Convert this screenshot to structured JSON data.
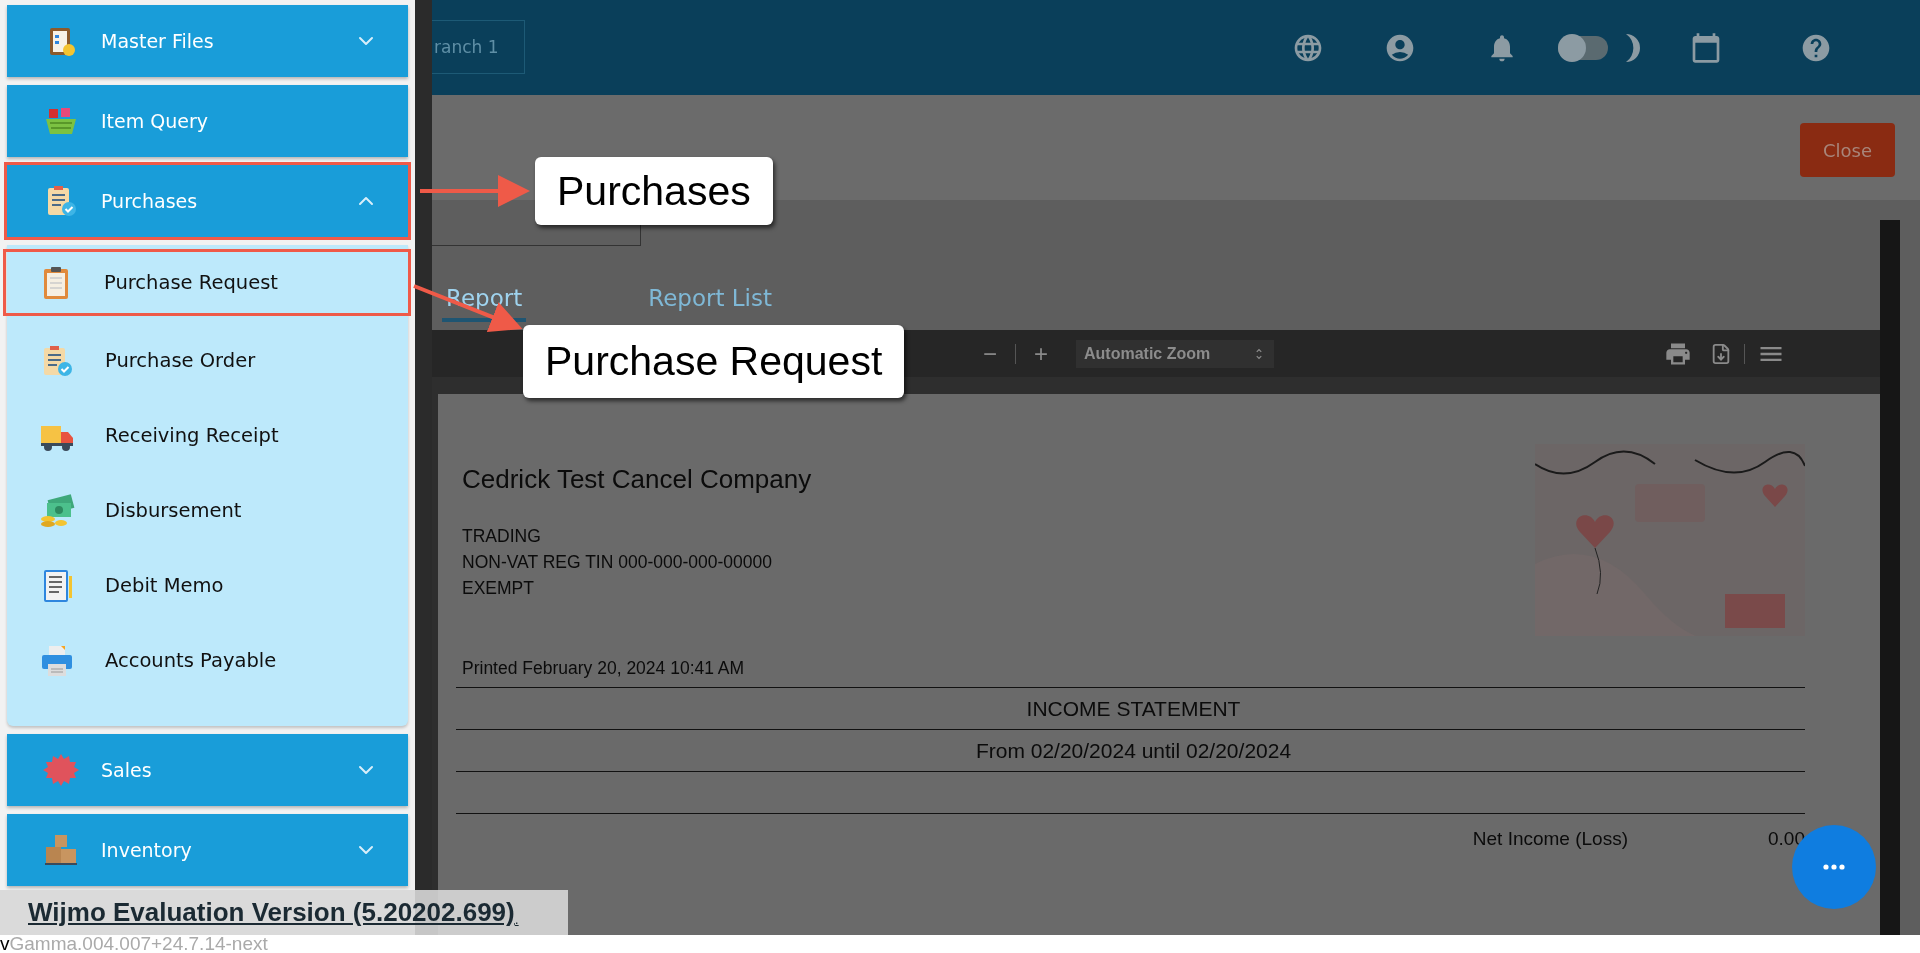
{
  "sidebar": {
    "items": [
      {
        "label": "Master Files",
        "expanded": false,
        "highlighted": false
      },
      {
        "label": "Item Query",
        "highlighted": false
      },
      {
        "label": "Purchases",
        "expanded": true,
        "highlighted": true,
        "children": [
          {
            "label": "Purchase Request",
            "highlighted": true
          },
          {
            "label": "Purchase Order",
            "highlighted": false
          },
          {
            "label": "Receiving Receipt",
            "highlighted": false
          },
          {
            "label": "Disbursement",
            "highlighted": false
          },
          {
            "label": "Debit Memo",
            "highlighted": false
          },
          {
            "label": "Accounts Payable",
            "highlighted": false
          }
        ]
      },
      {
        "label": "Sales",
        "expanded": false,
        "highlighted": false
      },
      {
        "label": "Inventory",
        "expanded": false,
        "highlighted": false
      }
    ]
  },
  "top_bar": {
    "branch": "ranch 1",
    "dark_mode": false
  },
  "header": {
    "close_button": "Close"
  },
  "tabs": [
    {
      "label": "Report",
      "selected": true
    },
    {
      "label": "Report List",
      "selected": false
    }
  ],
  "viewer_toolbar": {
    "zoom_out": "−",
    "zoom_in": "+",
    "zoom": "Automatic Zoom"
  },
  "report": {
    "company": "Cedrick Test Cancel Company",
    "details": [
      "TRADING",
      "NON-VAT REG TIN 000-000-000-00000",
      "EXEMPT"
    ],
    "printed": "Printed February 20, 2024 10:41 AM",
    "title": "INCOME STATEMENT",
    "period": "From 02/20/2024 until 02/20/2024",
    "rows": [
      {
        "label": "Net Income (Loss)",
        "value": "0.00"
      }
    ]
  },
  "callouts": [
    "Purchases",
    "Purchase Request"
  ],
  "notice": {
    "text": "Wijmo Evaluation Version (5.20202.699)",
    "suffix": "."
  },
  "version": {
    "prefix": "v",
    "text": "Gamma.004.007+24.7.14-next"
  }
}
